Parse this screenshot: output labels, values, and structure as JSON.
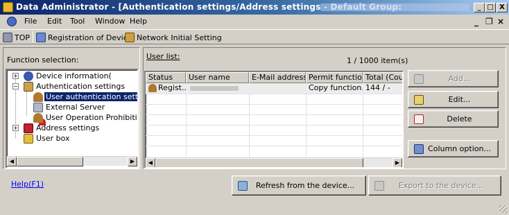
{
  "window": {
    "title": "Data Administrator - [Authentication settings/Address settings - Default Group:",
    "controls": {
      "minimize": "_",
      "maximize": "□",
      "close": "X"
    }
  },
  "menubar": {
    "app_icon": "app-globe-icon",
    "items": [
      {
        "label": "File",
        "accel": "F"
      },
      {
        "label": "Edit",
        "accel": "E"
      },
      {
        "label": "Tool",
        "accel": "T"
      },
      {
        "label": "Window",
        "accel": "W"
      },
      {
        "label": "Help",
        "accel": "p"
      }
    ],
    "mdi_controls": {
      "minimize": "_",
      "restore": "❐",
      "close": "×"
    }
  },
  "toolbar": {
    "top_label": "TOP",
    "registration_label": "Registration of Device",
    "network_label": "Network Initial Setting"
  },
  "function_panel": {
    "label": "Function selection:",
    "tree": [
      {
        "label": "Device information(",
        "expander": "+",
        "level": 0,
        "icon": "info-icon"
      },
      {
        "label": "Authentication settings",
        "expander": "−",
        "level": 0,
        "icon": "auth-icon"
      },
      {
        "label": "User authentication settings",
        "expander": "",
        "level": 1,
        "icon": "user-icon",
        "selected": true
      },
      {
        "label": "External Server",
        "expander": "",
        "level": 1,
        "icon": "server-icon"
      },
      {
        "label": "User Operation Prohibition S",
        "expander": "",
        "level": 1,
        "icon": "prohibit-icon"
      },
      {
        "label": "Address settings",
        "expander": "+",
        "level": 0,
        "icon": "address-icon"
      },
      {
        "label": "User box",
        "expander": "",
        "level": 0,
        "icon": "box-icon"
      }
    ]
  },
  "user_list": {
    "label": "User list:",
    "count": "1 / 1000 item(s)",
    "columns": [
      "Status",
      "User name",
      "E-Mail address",
      "Permit function",
      "Total (Cour"
    ],
    "rows": [
      {
        "status": "Regist...",
        "user_name": "",
        "email": "",
        "permit": "Copy function...",
        "total": "144 / -"
      }
    ]
  },
  "actions": {
    "add": "Add...",
    "edit": "Edit...",
    "delete": "Delete",
    "column_option": "Column option..."
  },
  "footer": {
    "help": "Help(F1)",
    "refresh": "Refresh from the device...",
    "export": "Export to the device..."
  },
  "colors": {
    "titlebar": "#0a246a",
    "face": "#d4d0c8",
    "selection": "#0a246a",
    "link": "#0000ff"
  }
}
